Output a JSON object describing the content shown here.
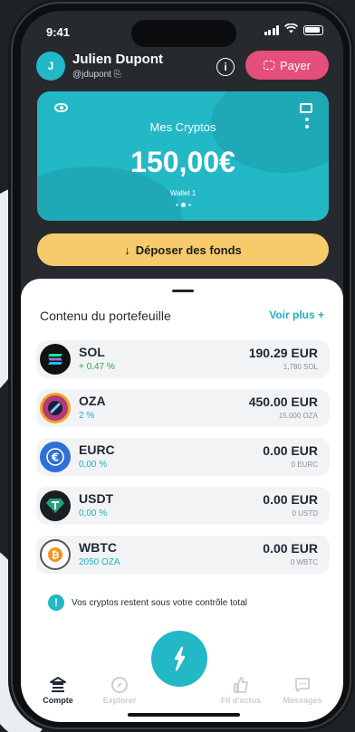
{
  "status": {
    "time": "9:41"
  },
  "header": {
    "avatar_initial": "J",
    "name": "Julien Dupont",
    "handle": "@jdupont ⎘",
    "info_icon": "i",
    "pay_label": "Payer"
  },
  "card": {
    "title": "Mes Cryptos",
    "amount": "150,00€",
    "wallet": "Wallet 1"
  },
  "deposit": {
    "arrow": "↓",
    "label": "Déposer des fonds"
  },
  "portfolio": {
    "title": "Contenu du portefeuille",
    "see_more": "Voir plus +",
    "assets": [
      {
        "symbol": "SOL",
        "change": "+ 0.47 %",
        "value": "190.29 EUR",
        "qty": "1,780 SOL",
        "icon": "sol-icon",
        "icon_color": "#111111",
        "change_color": "#2aa84a"
      },
      {
        "symbol": "OZA",
        "change": "2 %",
        "value": "450.00 EUR",
        "qty": "15.000 OZA",
        "icon": "oza-icon",
        "icon_color": "#b13a7a",
        "change_color": "#1fb0c0"
      },
      {
        "symbol": "EURC",
        "change": "0,00 %",
        "value": "0.00 EUR",
        "qty": "0 EURC",
        "icon": "eurc-icon",
        "icon_color": "#2f6fd6",
        "change_color": "#1fb0c0"
      },
      {
        "symbol": "USDT",
        "change": "0,00 %",
        "value": "0.00 EUR",
        "qty": "0 USTD",
        "icon": "usdt-icon",
        "icon_color": "#1b1f23",
        "change_color": "#1fb0c0"
      },
      {
        "symbol": "WBTC",
        "change": "2050 OZA",
        "value": "0.00 EUR",
        "qty": "0 WBTC",
        "icon": "wbtc-icon",
        "icon_color": "#f7931a",
        "change_color": "#1fb0c0"
      }
    ],
    "notice_icon": "!",
    "notice": "Vos cryptos restent sous votre contrôle total"
  },
  "fab": {
    "icon": "swap-icon"
  },
  "tabs": [
    {
      "label": "Compte",
      "icon": "bank-icon",
      "active": true
    },
    {
      "label": "Explorer",
      "icon": "compass-icon",
      "active": false
    },
    {
      "label": "Fil d'actus",
      "icon": "thumbs-up-icon",
      "active": false
    },
    {
      "label": "Messages",
      "icon": "chat-icon",
      "active": false
    }
  ]
}
